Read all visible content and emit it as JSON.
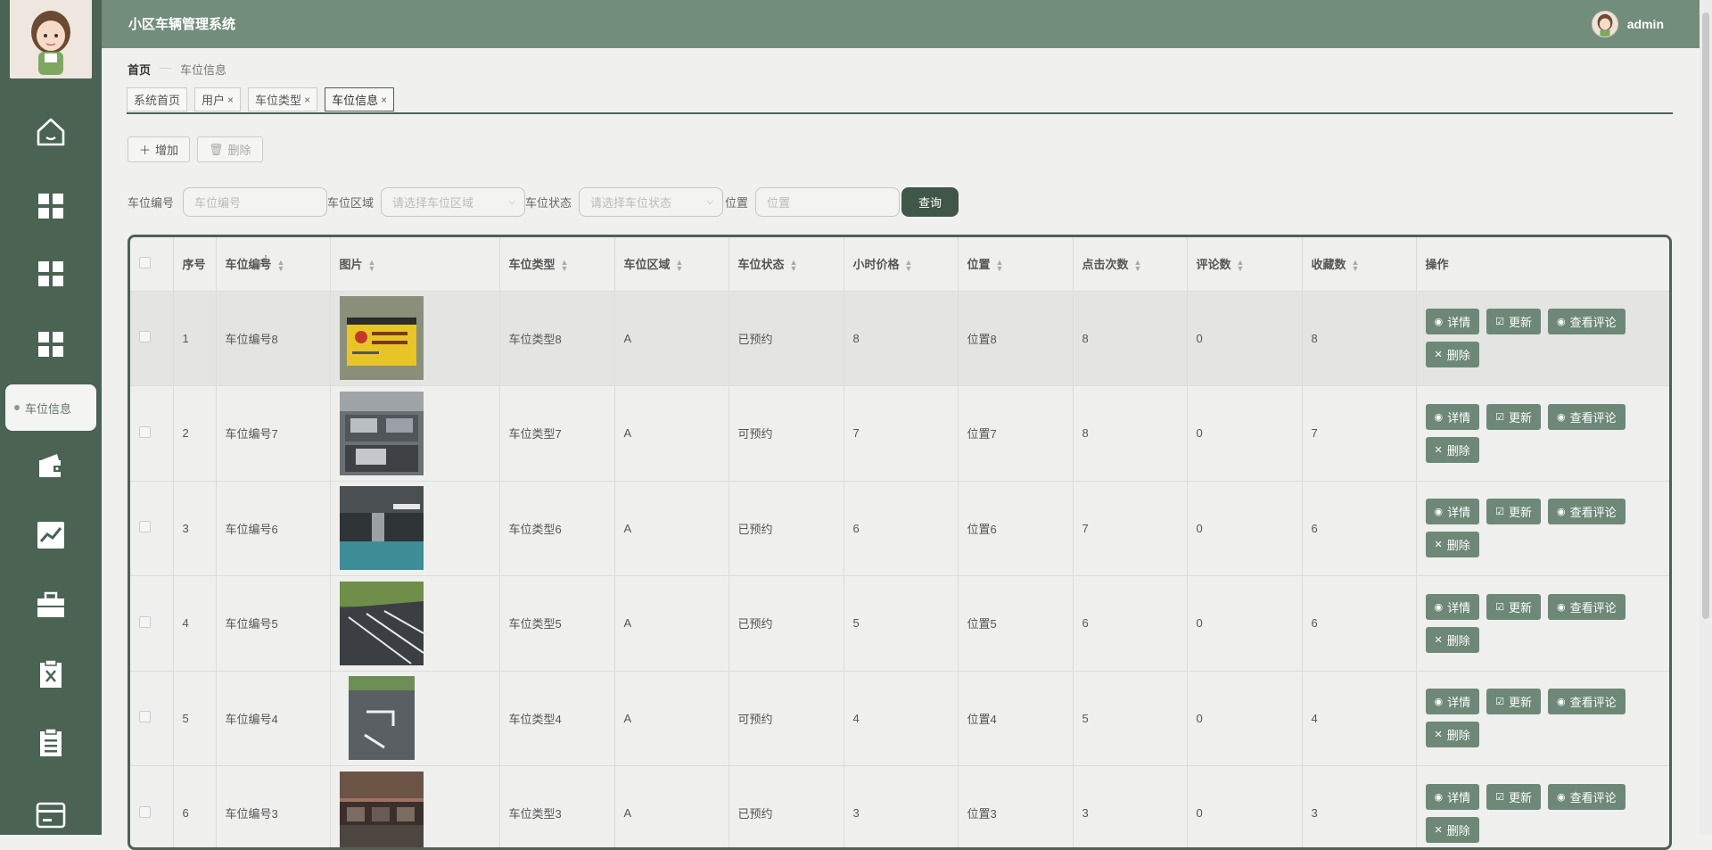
{
  "app": {
    "title": "小区车辆管理系统",
    "username": "admin"
  },
  "sidebar": {
    "active_item": "车位信息"
  },
  "breadcrumb": {
    "home": "首页",
    "separator": "—",
    "current": "车位信息"
  },
  "tabs": [
    {
      "label": "系统首页",
      "closable": false
    },
    {
      "label": "用户",
      "closable": true
    },
    {
      "label": "车位类型",
      "closable": true
    },
    {
      "label": "车位信息",
      "closable": true,
      "active": true
    }
  ],
  "tab_close": "×",
  "toolbar": {
    "add": "增加",
    "delete": "删除"
  },
  "search": {
    "code_label": "车位编号",
    "code_placeholder": "车位编号",
    "area_label": "车位区域",
    "area_placeholder": "请选择车位区域",
    "status_label": "车位状态",
    "status_placeholder": "请选择车位状态",
    "pos_label": "位置",
    "pos_placeholder": "位置",
    "query": "查询"
  },
  "table": {
    "headers": [
      "序号",
      "车位编号",
      "图片",
      "车位类型",
      "车位区域",
      "车位状态",
      "小时价格",
      "位置",
      "点击次数",
      "评论数",
      "收藏数",
      "操作"
    ],
    "rows": [
      [
        "1",
        "车位编号8",
        "车位类型8",
        "A",
        "已预约",
        "8",
        "位置8",
        "8",
        "0",
        "8"
      ],
      [
        "2",
        "车位编号7",
        "车位类型7",
        "A",
        "可预约",
        "7",
        "位置7",
        "8",
        "0",
        "7"
      ],
      [
        "3",
        "车位编号6",
        "车位类型6",
        "A",
        "已预约",
        "6",
        "位置6",
        "7",
        "0",
        "6"
      ],
      [
        "4",
        "车位编号5",
        "车位类型5",
        "A",
        "已预约",
        "5",
        "位置5",
        "6",
        "0",
        "6"
      ],
      [
        "5",
        "车位编号4",
        "车位类型4",
        "A",
        "可预约",
        "4",
        "位置4",
        "5",
        "0",
        "4"
      ],
      [
        "6",
        "车位编号3",
        "车位类型3",
        "A",
        "已预约",
        "3",
        "位置3",
        "3",
        "0",
        "3"
      ]
    ],
    "actions": {
      "detail": "详情",
      "update": "更新",
      "comments": "查看评论",
      "delete": "删除"
    }
  },
  "colors": {
    "sidebar": "#4a6353",
    "header": "#738d7d",
    "action_button": "#6e8878",
    "query_button": "#3f5649"
  }
}
